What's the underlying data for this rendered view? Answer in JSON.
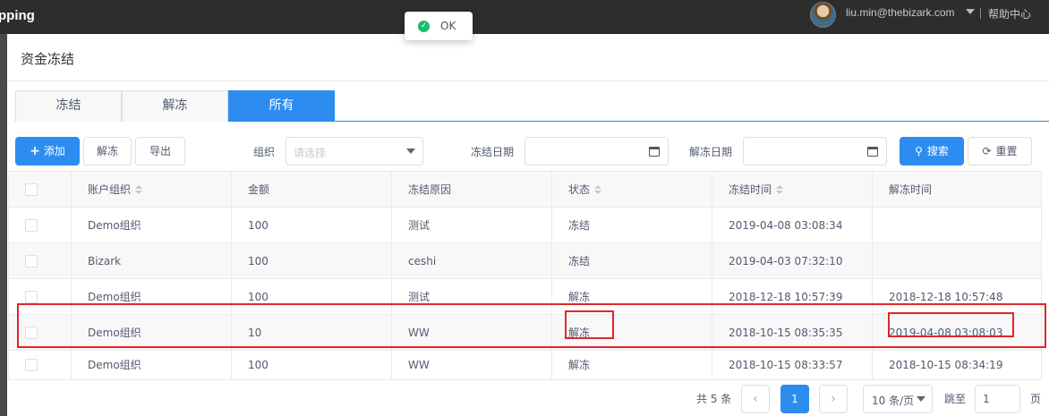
{
  "app": {
    "brand": "pping",
    "user_email": "liu.min@thebizark.com",
    "help": "帮助中心"
  },
  "toast": {
    "text": "OK"
  },
  "dialog": {
    "title": "资金冻结"
  },
  "tabs": [
    {
      "label": "冻结",
      "active": false
    },
    {
      "label": "解冻",
      "active": false
    },
    {
      "label": "所有",
      "active": true
    }
  ],
  "toolbar": {
    "add_icon": "+",
    "add_label": "添加",
    "unfreeze_label": "解冻",
    "export_label": "导出",
    "org_label": "组织",
    "org_placeholder": "请选择",
    "freeze_date_label": "冻结日期",
    "unfreeze_date_label": "解冻日期",
    "search_icon": "⚲",
    "search_label": "搜索",
    "reset_icon": "⟳",
    "reset_label": "重置"
  },
  "table": {
    "columns": [
      "账户组织",
      "金额",
      "冻结原因",
      "状态",
      "冻结时间",
      "解冻时间"
    ],
    "rows": [
      {
        "org": "Demo组织",
        "amount": "100",
        "reason": "测试",
        "status": "冻结",
        "freeze_time": "2019-04-08 03:08:34",
        "unfreeze_time": ""
      },
      {
        "org": "Bizark",
        "amount": "100",
        "reason": "ceshi",
        "status": "冻结",
        "freeze_time": "2019-04-03 07:32:10",
        "unfreeze_time": ""
      },
      {
        "org": "Demo组织",
        "amount": "100",
        "reason": "测试",
        "status": "解冻",
        "freeze_time": "2018-12-18 10:57:39",
        "unfreeze_time": "2018-12-18 10:57:48"
      },
      {
        "org": "Demo组织",
        "amount": "10",
        "reason": "WW",
        "status": "解冻",
        "freeze_time": "2018-10-15 08:35:35",
        "unfreeze_time": "2019-04-08 03:08:03"
      },
      {
        "org": "Demo组织",
        "amount": "100",
        "reason": "WW",
        "status": "解冻",
        "freeze_time": "2018-10-15 08:33:57",
        "unfreeze_time": "2018-10-15 08:34:19"
      }
    ]
  },
  "pagination": {
    "total": "共 5 条",
    "prev": "‹",
    "current": "1",
    "next": "›",
    "page_size": "10 条/页",
    "jump_label": "跳至",
    "jump_value": "1",
    "page_suffix": "页"
  },
  "colors": {
    "primary": "#2d8cf0",
    "highlight": "#e0262a",
    "success": "#19be6b"
  }
}
